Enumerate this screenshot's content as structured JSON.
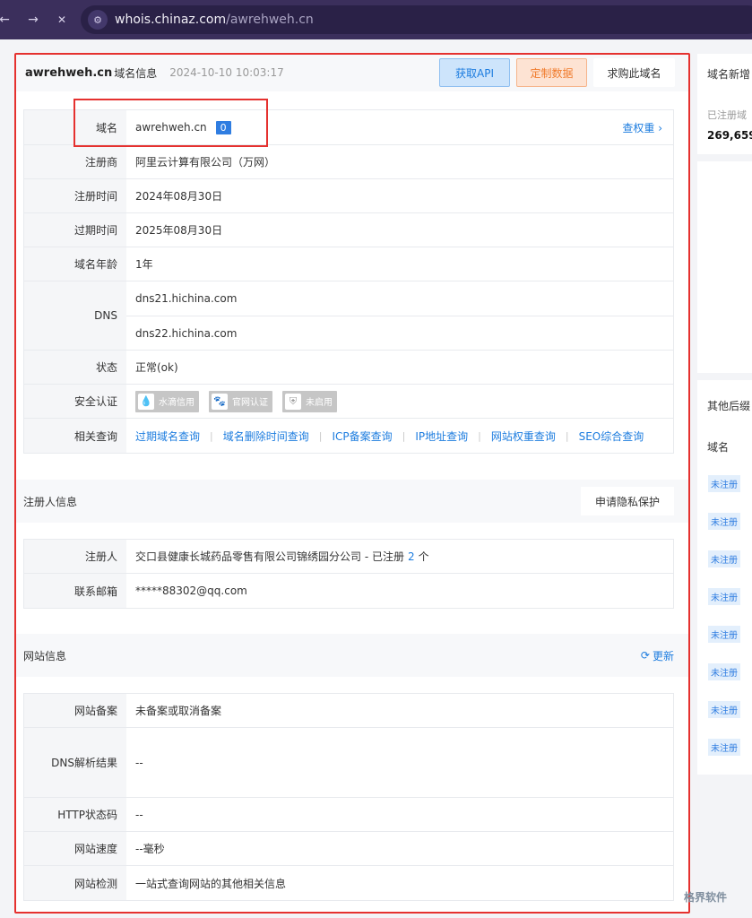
{
  "browser": {
    "back_icon": "←",
    "forward_icon": "→",
    "close_icon": "✕",
    "url_host": "whois.chinaz.com",
    "url_path": "/awrehweh.cn"
  },
  "header": {
    "domain": "awrehweh.cn",
    "suffix": "域名信息",
    "time": "2024-10-10 10:03:17",
    "api_button": "获取API",
    "custom_button": "定制数据",
    "buy_button": "求购此域名"
  },
  "domain_info": {
    "domain_label": "域名",
    "domain_value": "awrehweh.cn",
    "badge": "0",
    "weight_link": "查权重",
    "registrar_label": "注册商",
    "registrar_value": "阿里云计算有限公司（万网）",
    "reg_time_label": "注册时间",
    "reg_time_value": "2024年08月30日",
    "exp_time_label": "过期时间",
    "exp_time_value": "2025年08月30日",
    "age_label": "域名年龄",
    "age_value": "1年",
    "dns_label": "DNS",
    "dns_values": [
      "dns21.hichina.com",
      "dns22.hichina.com"
    ],
    "status_label": "状态",
    "status_value": "正常(ok)",
    "security_label": "安全认证",
    "security_badges": [
      "水滴信用",
      "官网认证",
      "未启用"
    ],
    "related_label": "相关查询",
    "related_links": [
      "过期域名查询",
      "域名删除时间查询",
      "ICP备案查询",
      "IP地址查询",
      "网站权重查询",
      "SEO综合查询"
    ]
  },
  "registrant": {
    "section_title": "注册人信息",
    "privacy_button": "申请隐私保护",
    "registrant_label": "注册人",
    "registrant_value": "交口县健康长城药品零售有限公司锦绣园分公司 - 已注册",
    "registrant_count": "2",
    "registrant_unit": "个",
    "email_label": "联系邮箱",
    "email_value": "*****88302@qq.com"
  },
  "website": {
    "section_title": "网站信息",
    "refresh_label": "更新",
    "record_label": "网站备案",
    "record_value": "未备案或取消备案",
    "dns_result_label": "DNS解析结果",
    "dns_result_value": "--",
    "http_label": "HTTP状态码",
    "http_value": "--",
    "speed_label": "网站速度",
    "speed_value": "--毫秒",
    "check_label": "网站检测",
    "check_value": "一站式查询网站的其他相关信息"
  },
  "sidebar": {
    "new_domains_title": "域名新增",
    "registered_sub": "已注册域",
    "registered_num": "269,659,",
    "other_suffix_title": "其他后缀",
    "domain_col": "域名",
    "unreg_tag": "未注册",
    "unreg_count": 8
  },
  "watermark": "格界软件",
  "colors": {
    "accent": "#1c7cdf",
    "highlight_red": "#e5312f",
    "browser_bar": "#3b2f5c"
  }
}
